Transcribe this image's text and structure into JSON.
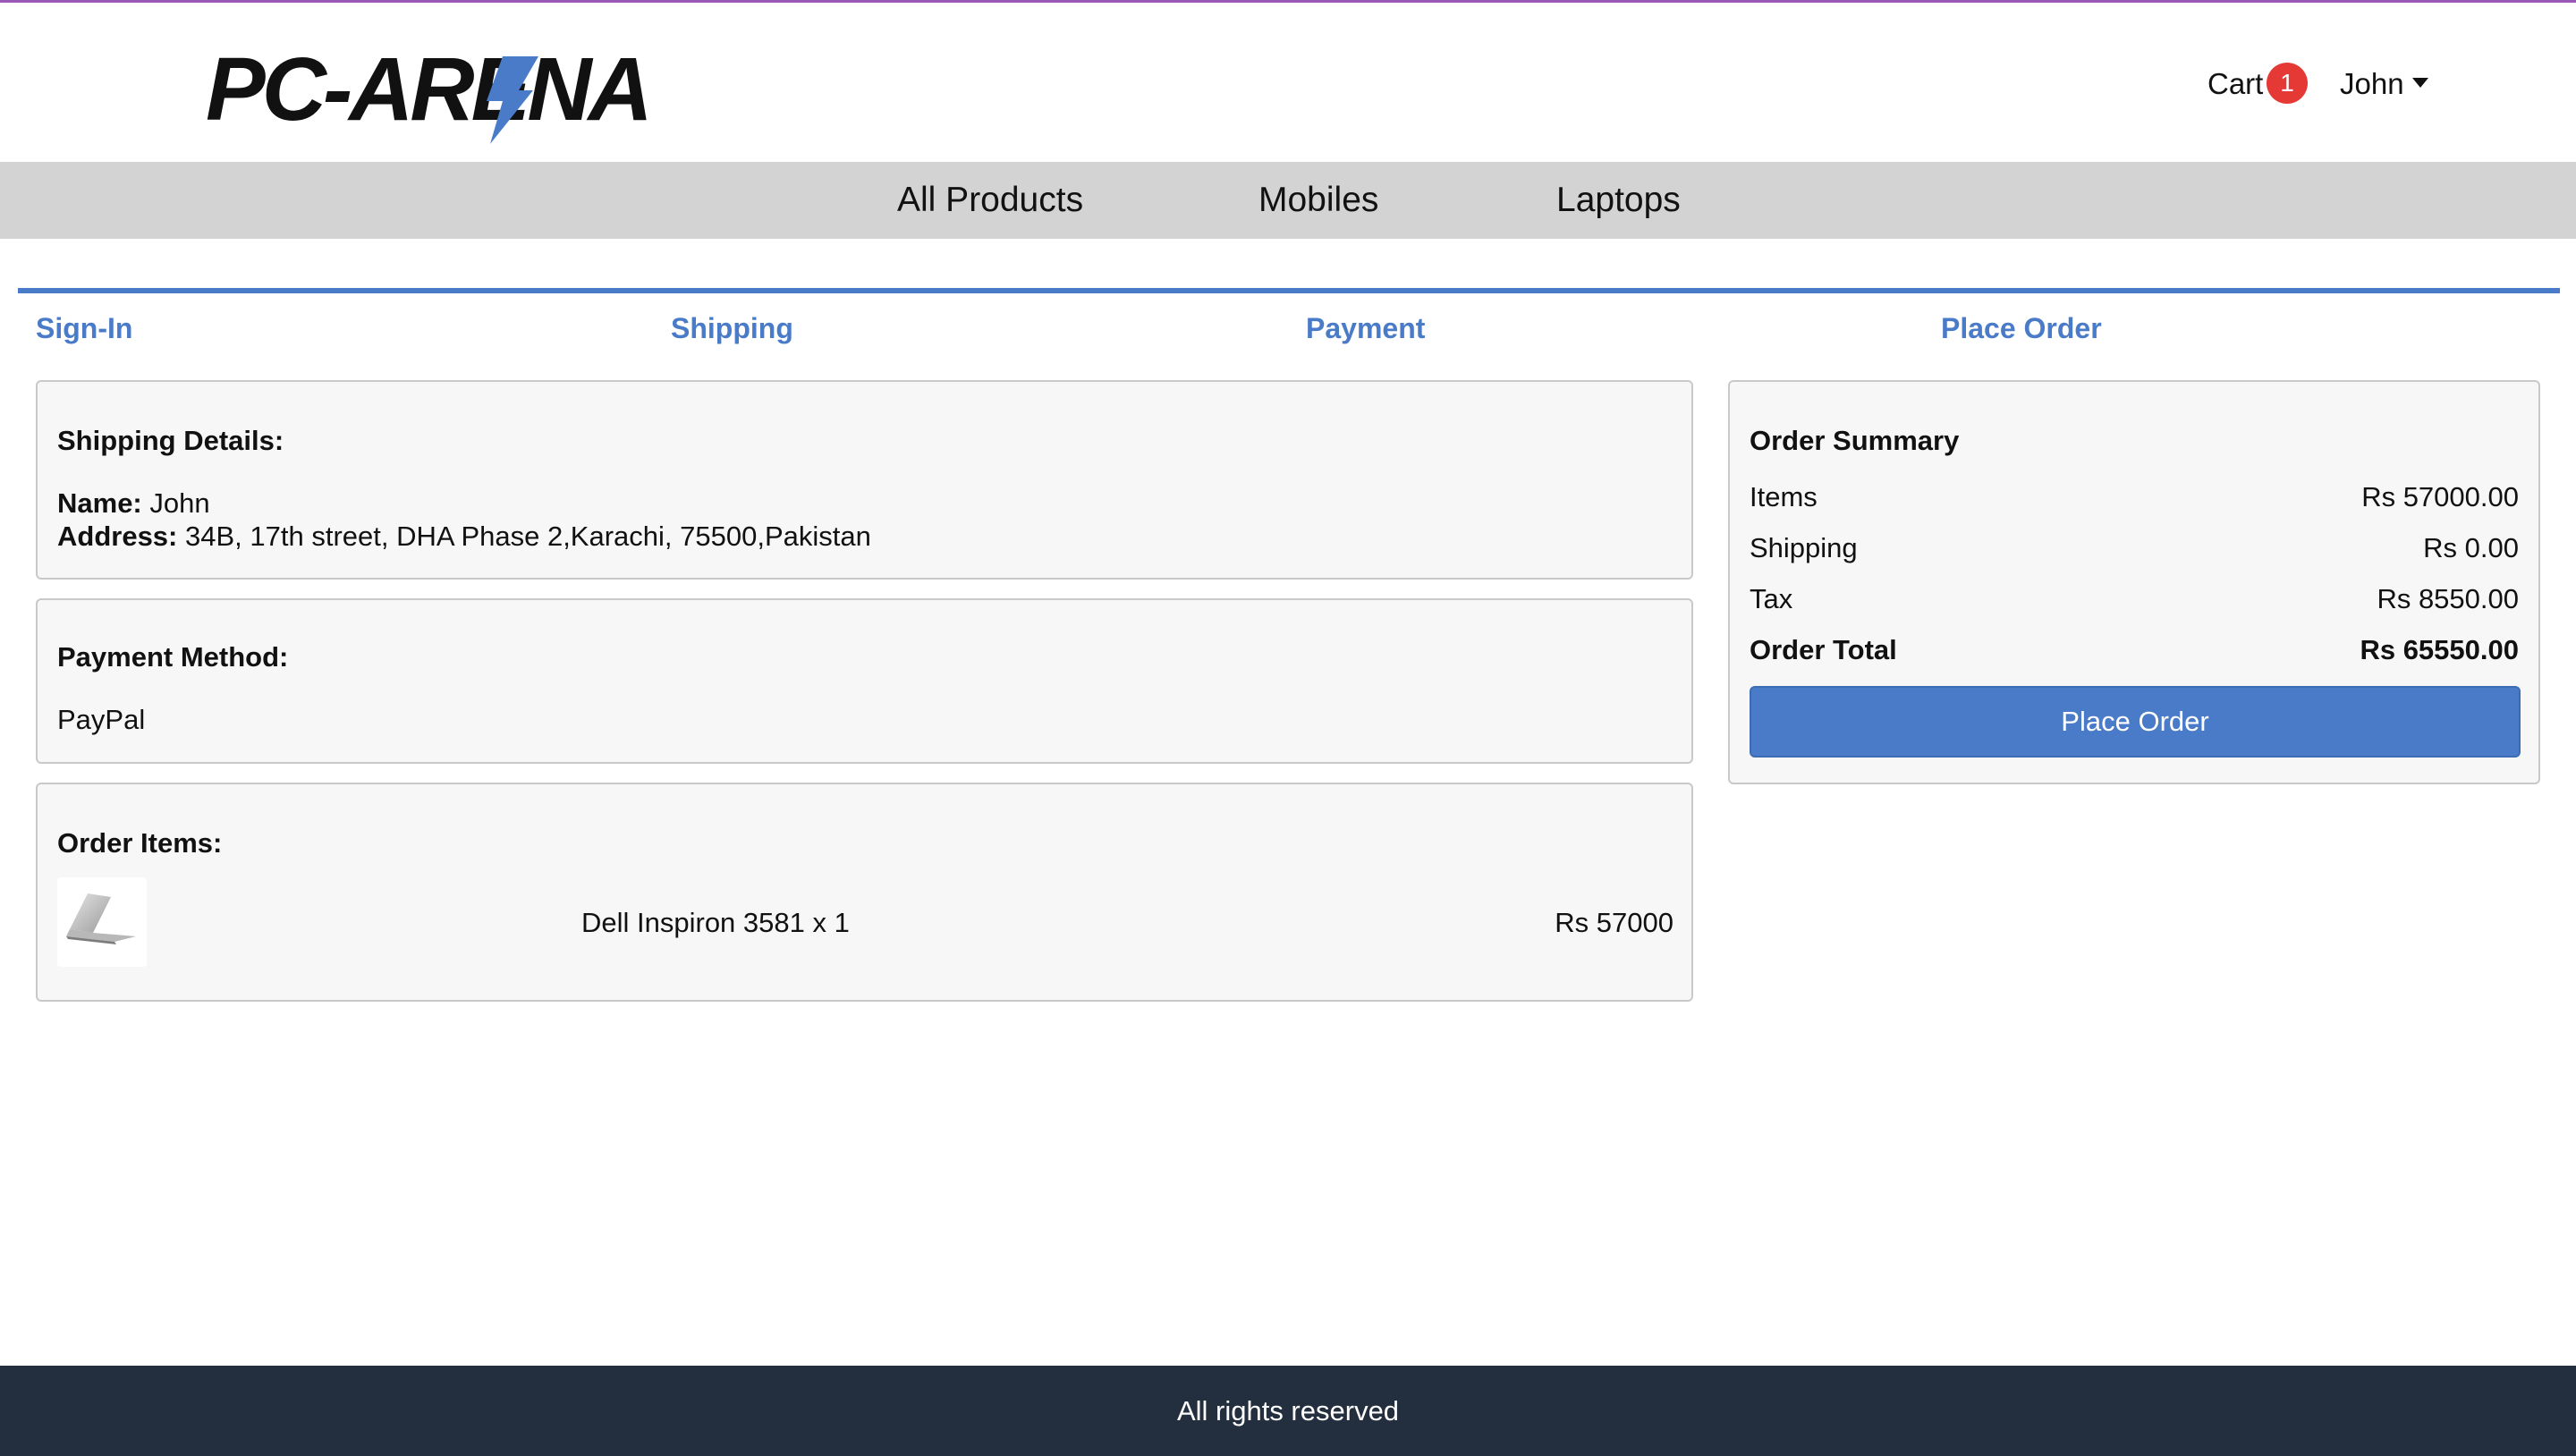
{
  "brand": {
    "logo_text": "PC-ARENA",
    "accent_color": "#4a7bc8"
  },
  "header": {
    "cart_label": "Cart",
    "cart_count": "1",
    "user_name": "John"
  },
  "nav": {
    "items": [
      "All Products",
      "Mobiles",
      "Laptops"
    ]
  },
  "steps": [
    "Sign-In",
    "Shipping",
    "Payment",
    "Place Order"
  ],
  "shipping": {
    "title": "Shipping Details:",
    "name_label": "Name:",
    "name_value": "John",
    "address_label": "Address:",
    "address_value": "34B, 17th street, DHA Phase 2,Karachi, 75500,Pakistan"
  },
  "payment": {
    "title": "Payment Method:",
    "method": "PayPal"
  },
  "order_items": {
    "title": "Order Items:",
    "items": [
      {
        "name": "Dell Inspiron 3581 x 1",
        "price": "Rs 57000",
        "icon": "laptop-thumbnail"
      }
    ]
  },
  "summary": {
    "title": "Order Summary",
    "rows": [
      {
        "label": "Items",
        "value": "Rs 57000.00"
      },
      {
        "label": "Shipping",
        "value": "Rs 0.00"
      },
      {
        "label": "Tax",
        "value": "Rs 8550.00"
      }
    ],
    "total_label": "Order Total",
    "total_value": "Rs 65550.00",
    "button_label": "Place Order"
  },
  "footer": {
    "text": "All rights reserved"
  }
}
